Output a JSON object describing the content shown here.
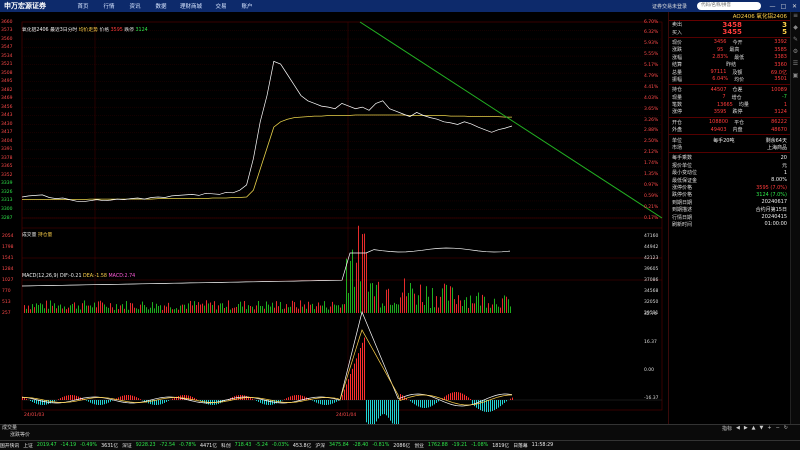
{
  "topbar": {
    "logo": "申万宏源证券",
    "nav": [
      "首页",
      "行情",
      "资讯",
      "数据",
      "理财商城",
      "交易",
      "账户"
    ],
    "right_text": "证券交易未登录",
    "search_placeholder": "代码/名称/拼音",
    "win_controls": [
      "—",
      "□",
      "✕"
    ]
  },
  "chart": {
    "header": {
      "name": "氧化铝2406",
      "cycle": "最近3日分时",
      "line1": "均价走势",
      "price_label": "价格",
      "price_val": "3595",
      "chg_label": "跌停",
      "chg_val": "3124"
    },
    "left_axis": [
      "3660",
      "3573",
      "3560",
      "3547",
      "3534",
      "3521",
      "3508",
      "3495",
      "3482",
      "3469",
      "3456",
      "3443",
      "3430",
      "3417",
      "3404",
      "3391",
      "3378",
      "3365",
      "3352",
      "3339",
      "3326",
      "3313",
      "3300",
      "3287"
    ],
    "right_axis": [
      "6.70%",
      "6.32%",
      "5.93%",
      "5.55%",
      "5.17%",
      "4.79%",
      "4.41%",
      "4.03%",
      "3.65%",
      "3.26%",
      "2.88%",
      "2.50%",
      "2.12%",
      "1.74%",
      "1.35%",
      "0.97%",
      "0.59%",
      "0.21%",
      "0.17%"
    ],
    "vol_header": {
      "label": "成交量",
      "vol": "持仓量"
    },
    "vol_left_axis": [
      "2054",
      "1798",
      "1541",
      "1284",
      "1027",
      "770",
      "513",
      "257"
    ],
    "vol_right_axis": [
      "47160",
      "44942",
      "42123",
      "39605",
      "37086",
      "34568",
      "32050",
      "29531"
    ],
    "macd_header": {
      "label": "MACD(12,26,9)",
      "dif": "DIF:-0.21",
      "dea": "DEA:-1.58",
      "macd": "MACD:2.74"
    },
    "macd_right_axis": [
      "32.74",
      "16.37",
      "0.00",
      "-16.37"
    ],
    "x_labels": [
      "24/01/03",
      "24/01/04"
    ]
  },
  "chart_data": {
    "type": "line",
    "title": "氧化铝2406",
    "series": [
      {
        "name": "价格",
        "values": [
          3327,
          3329,
          3330,
          3331,
          3326,
          3324,
          3325,
          3322,
          3319,
          3318,
          3320,
          3322,
          3320,
          3321,
          3323,
          3322,
          3324,
          3325,
          3323,
          3326,
          3327,
          3326,
          3329,
          3330,
          3331,
          3332,
          3330,
          3334,
          3333,
          3332,
          3336,
          3335,
          3340,
          3350,
          3400,
          3470,
          3520,
          3585,
          3580,
          3560,
          3540,
          3520,
          3510,
          3505,
          3500,
          3498,
          3495,
          3505,
          3500,
          3495,
          3498,
          3492,
          3505,
          3510,
          3495,
          3490,
          3485,
          3480,
          3488,
          3482,
          3478,
          3475,
          3470,
          3468,
          3465,
          3470,
          3466,
          3460,
          3455,
          3450,
          3455,
          3458,
          3462
        ]
      },
      {
        "name": "均价",
        "values": [
          3322,
          3322,
          3322,
          3322,
          3322,
          3322,
          3322,
          3322,
          3322,
          3322,
          3323,
          3323,
          3323,
          3323,
          3323,
          3323,
          3323,
          3323,
          3323,
          3323,
          3324,
          3324,
          3324,
          3324,
          3324,
          3324,
          3324,
          3324,
          3325,
          3325,
          3325,
          3326,
          3326,
          3327,
          3340,
          3380,
          3420,
          3460,
          3470,
          3475,
          3478,
          3479,
          3480,
          3481,
          3481,
          3482,
          3482,
          3482,
          3482,
          3483,
          3483,
          3483,
          3483,
          3483,
          3483,
          3483,
          3483,
          3482,
          3482,
          3482,
          3482,
          3482,
          3482,
          3481,
          3481,
          3481,
          3480,
          3480,
          3480,
          3480,
          3480,
          3479,
          3479
        ]
      }
    ],
    "ylim": [
      3287,
      3660
    ]
  },
  "side": {
    "title": "AO2406 氧化铝2406",
    "ask": {
      "label": "卖出",
      "price": "3458",
      "vol": "3"
    },
    "bid": {
      "label": "买入",
      "price": "3455",
      "vol": "5"
    },
    "rows1": [
      [
        "现价",
        "3456",
        "今开",
        "3392"
      ],
      [
        "涨跌",
        "95",
        "最高",
        "3585"
      ],
      [
        "涨幅",
        "2.83%",
        "最低",
        "3383"
      ],
      [
        "结算",
        "",
        "昨结",
        "3360"
      ],
      [
        "总量",
        "97111",
        "及额",
        "69.0亿"
      ],
      [
        "振幅",
        "6.04%",
        "均价",
        "3501"
      ]
    ],
    "rows2": [
      [
        "持仓",
        "44507",
        "仓差",
        "10089"
      ],
      [
        "现量",
        "7",
        "增仓",
        "-7"
      ],
      [
        "笔数",
        "13665",
        "均量",
        "1"
      ],
      [
        "涨停",
        "3595",
        "跌停",
        "3124"
      ]
    ],
    "rows3": [
      [
        "开仓",
        "108800",
        "平仓",
        "86222"
      ],
      [
        "外盘",
        "49403",
        "内盘",
        "48670"
      ]
    ],
    "unit": [
      "单位",
      "每手20吨",
      "剩余64天"
    ],
    "market": [
      "市场",
      "",
      "上海商品"
    ],
    "info": [
      [
        "每手乘数",
        "20"
      ],
      [
        "报价单位",
        "元"
      ],
      [
        "最小变动位",
        "1"
      ],
      [
        "最低保证金",
        "8.00%"
      ],
      [
        "涨停价格",
        "3595 (7.0%)"
      ],
      [
        "跌停价格",
        "3124 (7.0%)"
      ],
      [
        "到期日期",
        "20240617"
      ],
      [
        "到期描述",
        "合约月第15日"
      ],
      [
        "行情日期",
        "20240415"
      ],
      [
        "刷新时间",
        "01:00:00"
      ]
    ]
  },
  "bottom": {
    "tab1": "成交量",
    "tab2": "涨跌等价",
    "page": "指标",
    "arrows": [
      "◀",
      "▶",
      "▲",
      "▼",
      "+",
      "−",
      "↻"
    ]
  },
  "status": [
    {
      "t": "国开快讯",
      "c": "white"
    },
    {
      "t": "上证",
      "c": "white"
    },
    {
      "t": "2019.47",
      "c": "green"
    },
    {
      "t": "-14.19",
      "c": "green"
    },
    {
      "t": "-0.49%",
      "c": "green"
    },
    {
      "t": "3631亿",
      "c": "white"
    },
    {
      "t": "深证",
      "c": "white"
    },
    {
      "t": "9228.23",
      "c": "green"
    },
    {
      "t": "-72.54",
      "c": "green"
    },
    {
      "t": "-0.78%",
      "c": "green"
    },
    {
      "t": "4471亿",
      "c": "white"
    },
    {
      "t": "科创",
      "c": "white"
    },
    {
      "t": "718.43",
      "c": "green"
    },
    {
      "t": "-5.24",
      "c": "green"
    },
    {
      "t": "-0.03%",
      "c": "green"
    },
    {
      "t": "453.8亿",
      "c": "white"
    },
    {
      "t": "沪深",
      "c": "white"
    },
    {
      "t": "3475.84",
      "c": "green"
    },
    {
      "t": "-28.40",
      "c": "green"
    },
    {
      "t": "-0.81%",
      "c": "green"
    },
    {
      "t": "2086亿",
      "c": "white"
    },
    {
      "t": "创业",
      "c": "white"
    },
    {
      "t": "1762.88",
      "c": "green"
    },
    {
      "t": "-19.21",
      "c": "green"
    },
    {
      "t": "-1.08%",
      "c": "green"
    },
    {
      "t": "1819亿",
      "c": "white"
    },
    {
      "t": "日落幕",
      "c": "white"
    },
    {
      "t": "11:58:29",
      "c": "white"
    }
  ]
}
